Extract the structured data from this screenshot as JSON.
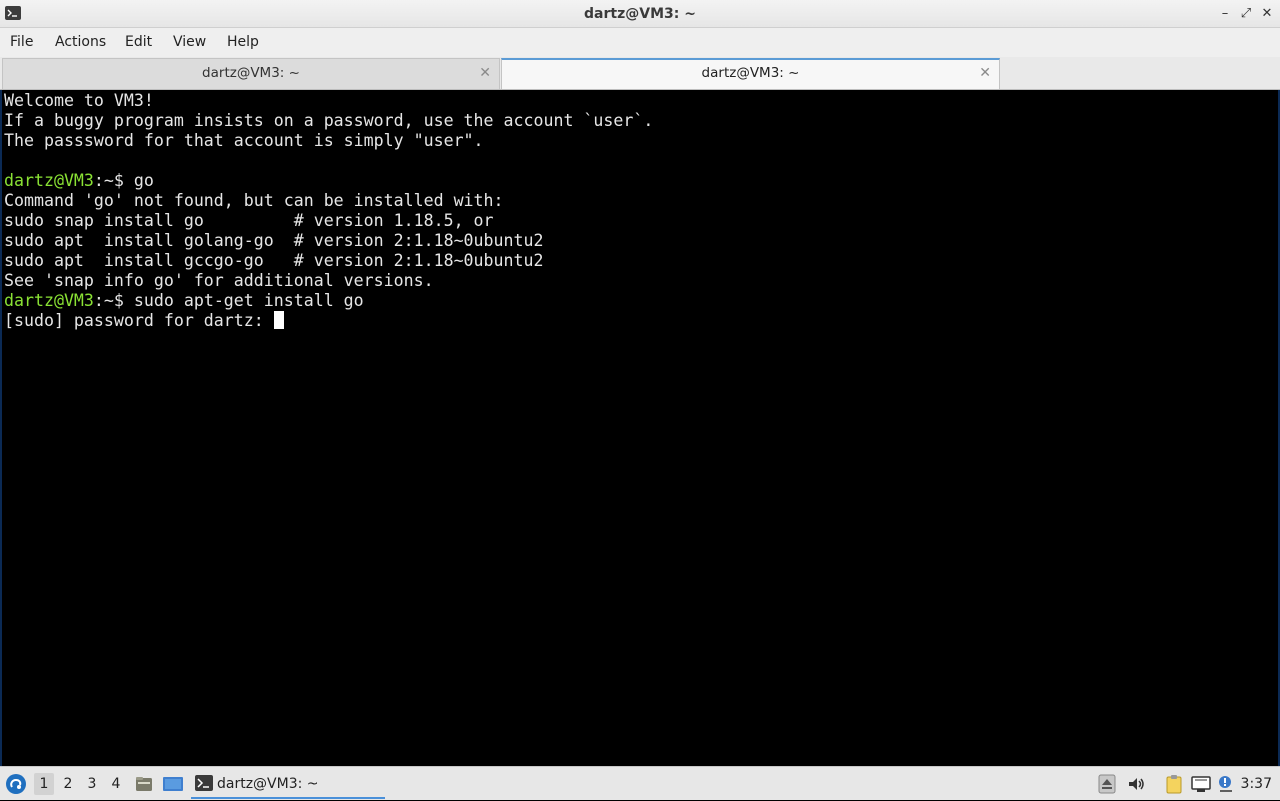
{
  "window": {
    "title": "dartz@VM3: ~"
  },
  "menu": [
    "File",
    "Actions",
    "Edit",
    "View",
    "Help"
  ],
  "tabs": [
    {
      "label": "dartz@VM3: ~",
      "active": false
    },
    {
      "label": "dartz@VM3: ~",
      "active": true
    }
  ],
  "terminal": {
    "lines": [
      {
        "text": "Welcome to VM3!"
      },
      {
        "text": "If a buggy program insists on a password, use the account `user`."
      },
      {
        "text": "The passsword for that account is simply \"user\"."
      },
      {
        "text": ""
      },
      {
        "prompt_user": "dartz@VM3",
        "prompt_path": ":~$ ",
        "text": "go"
      },
      {
        "text": "Command 'go' not found, but can be installed with:"
      },
      {
        "text": "sudo snap install go         # version 1.18.5, or"
      },
      {
        "text": "sudo apt  install golang-go  # version 2:1.18~0ubuntu2"
      },
      {
        "text": "sudo apt  install gccgo-go   # version 2:1.18~0ubuntu2"
      },
      {
        "text": "See 'snap info go' for additional versions."
      },
      {
        "prompt_user": "dartz@VM3",
        "prompt_path": ":~$ ",
        "text": "sudo apt-get install go"
      },
      {
        "text": "[sudo] password for dartz: "
      }
    ]
  },
  "taskbar": {
    "workspaces": [
      "1",
      "2",
      "3",
      "4"
    ],
    "current_workspace": "1",
    "task_label": "dartz@VM3: ~",
    "clock": "3:37"
  },
  "colors": {
    "prompt_user": "#8ae234",
    "terminal_bg": "#000000",
    "terminal_fg": "#e6e6e6",
    "accent": "#4a90d9"
  }
}
